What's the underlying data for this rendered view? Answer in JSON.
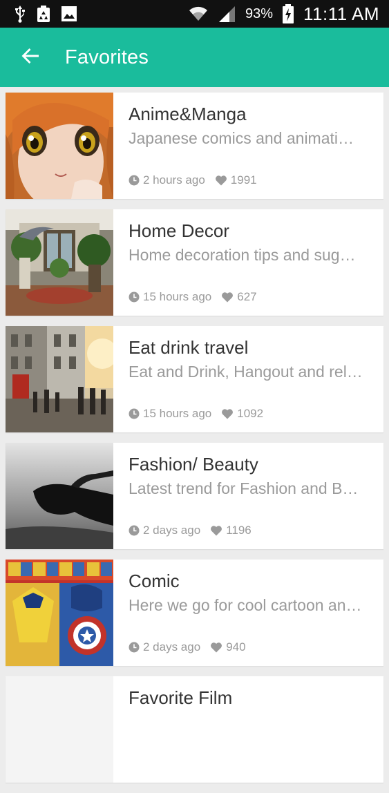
{
  "status_bar": {
    "battery": "93%",
    "time": "11:11 AM",
    "icons": [
      "usb-icon",
      "recycle-icon",
      "gallery-icon",
      "wifi-icon",
      "signal-icon",
      "battery-charging-icon"
    ]
  },
  "app_bar": {
    "title": "Favorites",
    "back_icon": "arrow-left-icon",
    "color": "#1abc9c"
  },
  "list": {
    "items": [
      {
        "title": "Anime&Manga",
        "description": "Japanese comics and animati…",
        "time": "2 hours ago",
        "likes": "1991",
        "image": "anime-doll-image"
      },
      {
        "title": "Home Decor",
        "description": "Home decoration tips and sug…",
        "time": "15 hours ago",
        "likes": "627",
        "image": "interior-room-image"
      },
      {
        "title": "Eat drink travel",
        "description": "Eat and Drink, Hangout and rel…",
        "time": "15 hours ago",
        "likes": "1092",
        "image": "city-street-image"
      },
      {
        "title": "Fashion/ Beauty",
        "description": "Latest trend for Fashion and B…",
        "time": "2 days ago",
        "likes": "1196",
        "image": "sunglasses-image"
      },
      {
        "title": "Comic",
        "description": "Here we go for cool cartoon an…",
        "time": "2 days ago",
        "likes": "940",
        "image": "comics-collage-image"
      },
      {
        "title": "Favorite Film",
        "description": "",
        "time": "",
        "likes": "",
        "image": "film-image"
      }
    ]
  }
}
